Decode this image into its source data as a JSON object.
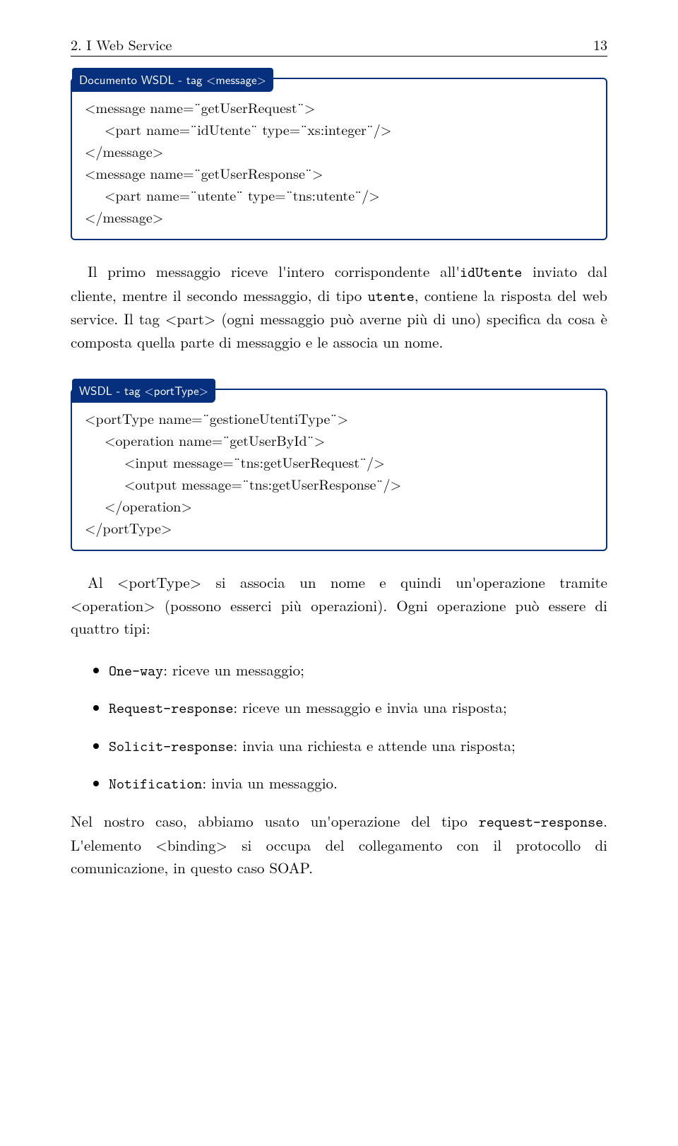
{
  "header": {
    "left": "2. I Web Service",
    "page_num": "13"
  },
  "box1": {
    "title": "Documento WSDL - tag <message>",
    "lines": [
      "<message name=¨getUserRequest¨>",
      "<part name=¨idUtente¨ type=¨xs:integer¨/>",
      "</message>",
      "<message name=¨getUserResponse¨>",
      "<part name=¨utente¨ type=¨tns:utente¨/>",
      "</message>"
    ]
  },
  "para1_a": "Il primo messaggio riceve l'intero corrispondente all'",
  "para1_b": " inviato dal cliente, mentre il secondo messaggio, di tipo ",
  "para1_c": ", contiene la risposta del web service. Il tag <part> (ogni messaggio può averne più di uno) specifica da cosa è composta quella parte di messaggio e le associa un nome.",
  "para1_tt1": "idUtente",
  "para1_tt2": "utente",
  "box2": {
    "title": "WSDL - tag <portType>",
    "lines": [
      "<portType name=¨gestioneUtentiType¨>",
      "<operation name=¨getUserById¨>",
      "<input message=¨tns:getUserRequest¨/>",
      "<output message=¨tns:getUserResponse¨/>",
      "</operation>",
      "</portType>"
    ]
  },
  "para2": "Al <portType> si associa un nome e quindi un'operazione tramite <operation> (possono esserci più operazioni). Ogni operazione può essere di quattro tipi:",
  "bullets": {
    "b1_tt": "One-way",
    "b1_txt": ": riceve un messaggio;",
    "b2_tt": "Request-response",
    "b2_txt": ": riceve un messaggio e invia una risposta;",
    "b3_tt": "Solicit-response",
    "b3_txt": ": invia una richiesta e attende una risposta;",
    "b4_tt": "Notification",
    "b4_txt": ": invia un messaggio."
  },
  "para3_a": "Nel nostro caso, abbiamo usato un'operazione del tipo ",
  "para3_tt": "request-response",
  "para3_b": ". L'elemento <binding> si occupa del collegamento con il protocollo di comunicazione, in questo caso SOAP."
}
